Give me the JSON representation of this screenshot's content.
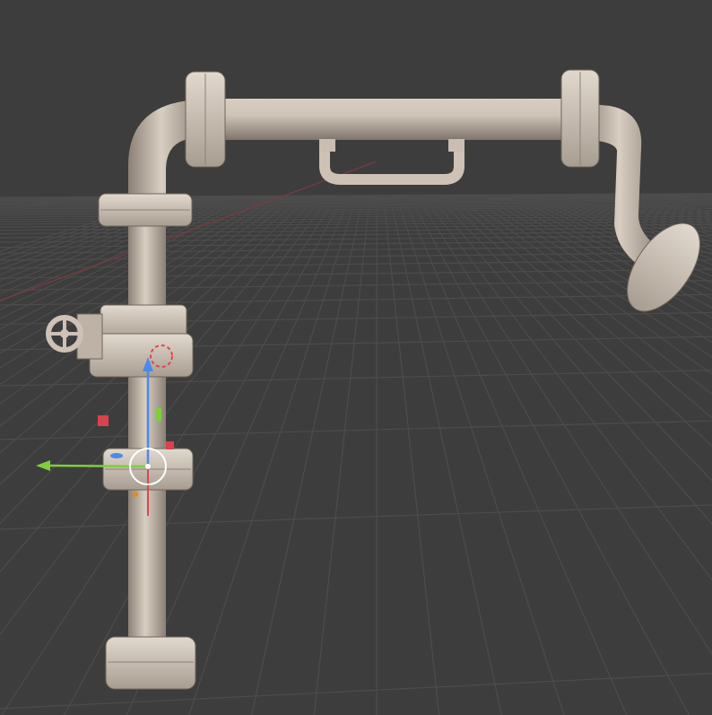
{
  "viewport": {
    "background_color": "#3d3d3d",
    "grid_color": "#4d4d4d",
    "x_axis_color": "#7a3a42",
    "pipe_color": "#cbbfb2",
    "pipe_shadow_color": "#8f8478",
    "flange_color": "#d6ccc0",
    "gizmo_x_color": "#e0454f",
    "gizmo_y_color": "#7ecf3a",
    "gizmo_z_color": "#4d8ae8"
  }
}
